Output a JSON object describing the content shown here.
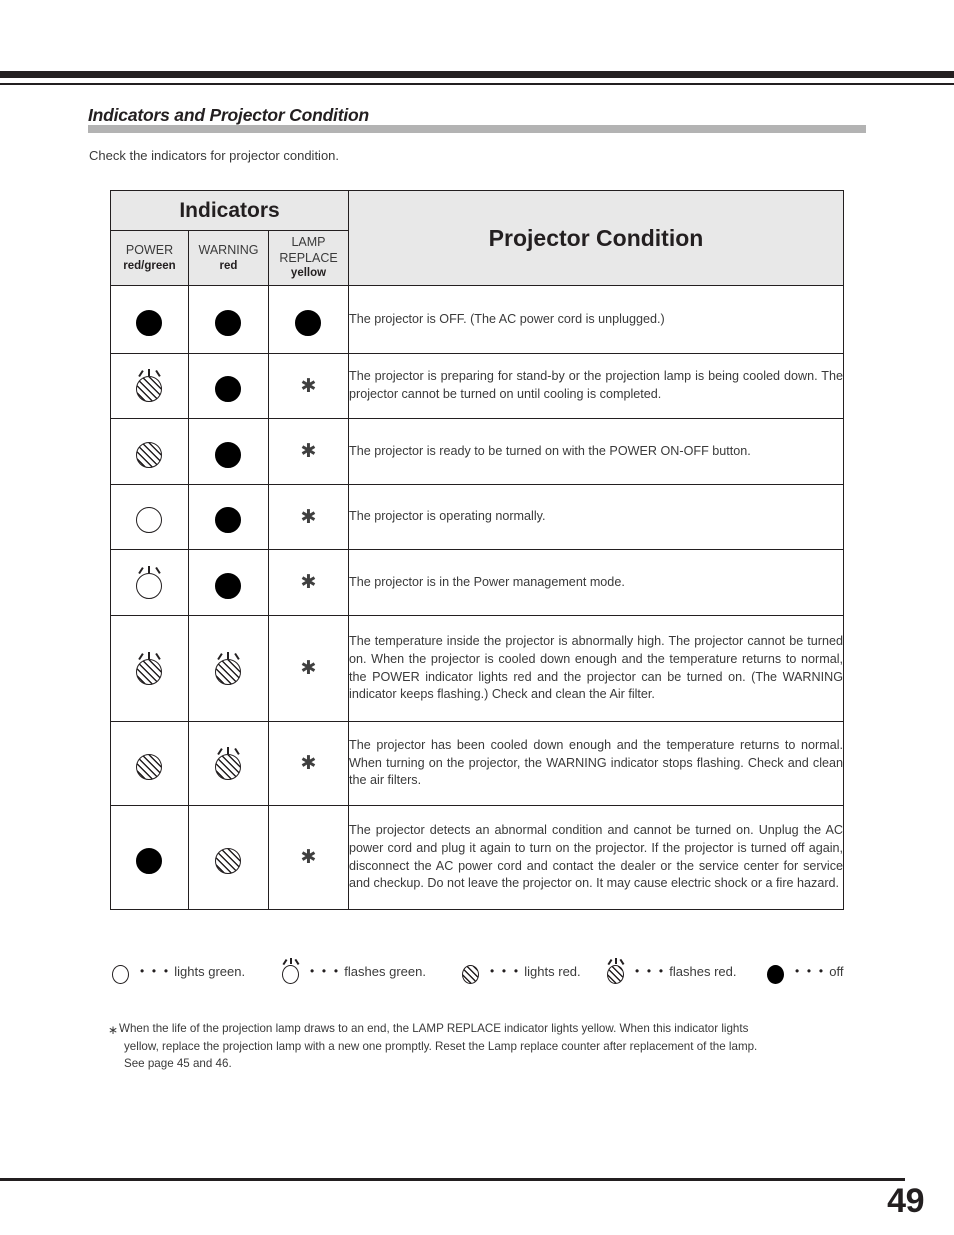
{
  "page": {
    "section_title": "Indicators and Projector Condition",
    "intro": "Check the indicators for projector condition.",
    "page_number": "49"
  },
  "table": {
    "group_header": "Indicators",
    "condition_header": "Projector Condition",
    "columns": [
      {
        "name": "POWER",
        "color": "red/green"
      },
      {
        "name": "WARNING",
        "color": "red"
      },
      {
        "name": "LAMP REPLACE",
        "color": "yellow",
        "name_line1": "LAMP",
        "name_line2": "REPLACE"
      }
    ],
    "rows": [
      {
        "power": "off",
        "warning": "off",
        "lamp": "off",
        "condition": "The projector is OFF.  (The AC power cord is unplugged.)"
      },
      {
        "power": "flashes-red",
        "warning": "off",
        "lamp": "asterisk",
        "condition": "The projector is preparing for stand-by or the projection lamp is being cooled down.  The projector cannot be turned on until cooling is completed."
      },
      {
        "power": "lights-red",
        "warning": "off",
        "lamp": "asterisk",
        "condition": "The projector is ready to be turned on with the POWER ON-OFF button."
      },
      {
        "power": "lights-green",
        "warning": "off",
        "lamp": "asterisk",
        "condition": "The projector is operating normally."
      },
      {
        "power": "flashes-green",
        "warning": "off",
        "lamp": "asterisk",
        "condition": "The projector is in the Power management mode."
      },
      {
        "power": "flashes-red",
        "warning": "flashes-red",
        "lamp": "asterisk",
        "condition": "The temperature inside the projector is abnormally high.  The projector cannot be turned on.  When  the projector is cooled down enough and the temperature returns to normal, the POWER indicator lights red and the projector can be turned on.  (The WARNING indicator keeps flashing.)  Check and clean the Air filter."
      },
      {
        "power": "lights-red",
        "warning": "flashes-red",
        "lamp": "asterisk",
        "condition": "The projector has been cooled down enough and the temperature returns to normal.  When turning on the projector, the WARNING indicator stops flashing.  Check and clean the air filters."
      },
      {
        "power": "off",
        "warning": "lights-red",
        "lamp": "asterisk",
        "condition": "The projector detects an abnormal condition and cannot be turned on. Unplug the AC power cord and plug it again to turn on the projector.  If the projector is turned off again, disconnect the AC power cord and contact the dealer or the service center for service and checkup.  Do not leave the projector on.  It may cause electric shock or a fire hazard."
      }
    ]
  },
  "legend": {
    "dots": "• • •",
    "items": [
      {
        "symbol": "lights-green",
        "label": "lights green."
      },
      {
        "symbol": "flashes-green",
        "label": "flashes green."
      },
      {
        "symbol": "lights-red",
        "label": "lights red."
      },
      {
        "symbol": "flashes-red",
        "label": "flashes red."
      },
      {
        "symbol": "off",
        "label": "off"
      }
    ]
  },
  "footnote": {
    "mark": "∗",
    "line1": "When the life of the projection lamp draws to an end, the LAMP REPLACE indicator lights yellow.  When this indicator lights",
    "line2": "yellow, replace the projection lamp with a new one promptly.  Reset the Lamp replace counter after replacement of the lamp.",
    "line3": "See page 45 and 46."
  },
  "symbols": {
    "asterisk": "✱"
  }
}
